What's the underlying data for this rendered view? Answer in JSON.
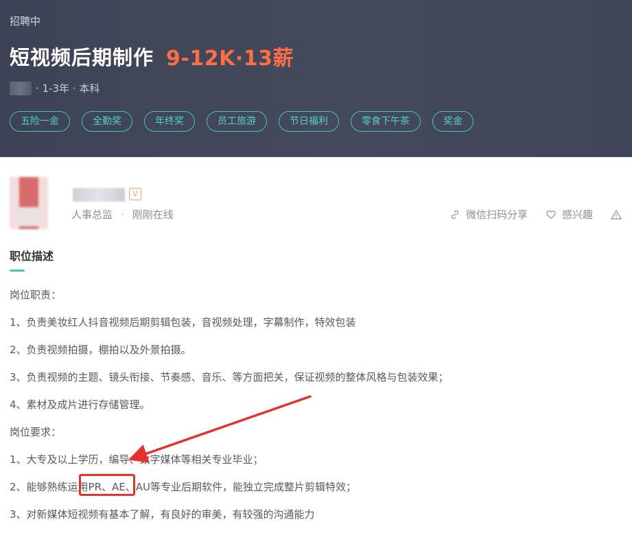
{
  "header": {
    "status": "招聘中",
    "job_title": "短视频后期制作",
    "salary": "9-12K·13薪",
    "meta": "· 1-3年 · 本科",
    "benefits": [
      "五险一金",
      "全勤奖",
      "年终奖",
      "员工旅游",
      "节日福利",
      "零食下午茶",
      "奖金"
    ]
  },
  "recruiter": {
    "role": "人事总监",
    "separator": "·",
    "online_status": "刚刚在线",
    "verified_badge": "V",
    "actions": {
      "share": "微信扫码分享",
      "interest": "感兴趣"
    }
  },
  "description": {
    "title": "职位描述",
    "lines": [
      "岗位职责：",
      "1、负责美妆红人抖音视频后期剪辑包装，音视频处理，字幕制作，特效包装",
      "2、负责视频拍摄，棚拍以及外景拍摄。",
      "3、负责视频的主题、镜头衔接、节奏感、音乐、等方面把关，保证视频的整体风格与包装效果；",
      "4、素材及成片进行存储管理。",
      "岗位要求：",
      "1、大专及以上学历，编导、数字媒体等相关专业毕业；",
      "2、能够熟练运用PR、AE、AU等专业后期软件，能独立完成整片剪辑特效；",
      "3、对新媒体短视频有基本了解，有良好的审美，有较强的沟通能力"
    ]
  },
  "colors": {
    "header_bg": "#404558",
    "salary": "#fe6e45",
    "accent": "#3fc7c0",
    "annotation": "#e53030"
  },
  "icons": [
    "link-icon",
    "heart-icon",
    "warning-icon",
    "verified-icon"
  ]
}
